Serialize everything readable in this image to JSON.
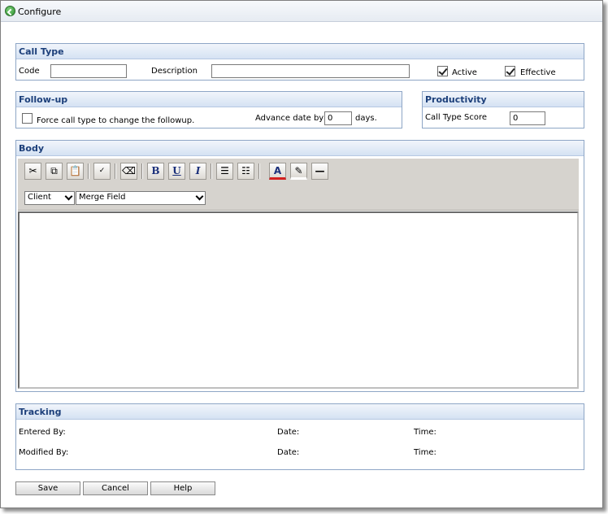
{
  "window": {
    "title": "Configure"
  },
  "call_type": {
    "heading": "Call Type",
    "code_label": "Code",
    "code_value": "",
    "description_label": "Description",
    "description_value": "",
    "active_label": "Active",
    "active_checked": true,
    "effective_label": "Effective",
    "effective_checked": true
  },
  "followup": {
    "heading": "Follow-up",
    "force_label": "Force call type to change the followup.",
    "force_checked": false,
    "advance_label": "Advance date by",
    "advance_value": "0",
    "days_label": "days."
  },
  "productivity": {
    "heading": "Productivity",
    "score_label": "Call Type Score",
    "score_value": "0"
  },
  "body": {
    "heading": "Body",
    "toolbar_icons": [
      "cut-icon",
      "copy-icon",
      "paste-icon",
      "spellcheck-icon",
      "eraser-icon",
      "bold-icon",
      "underline-icon",
      "italic-icon",
      "ordered-list-icon",
      "unordered-list-icon",
      "font-color-icon",
      "highlight-icon",
      "horizontal-rule-icon"
    ],
    "bold_glyph": "B",
    "underline_glyph": "U",
    "italic_glyph": "I",
    "client_select": "Client",
    "merge_select": "Merge Field"
  },
  "tracking": {
    "heading": "Tracking",
    "entered_by_label": "Entered By:",
    "modified_by_label": "Modified By:",
    "date_label": "Date:",
    "time_label": "Time:"
  },
  "buttons": {
    "save": "Save",
    "cancel": "Cancel",
    "help": "Help"
  },
  "colors": {
    "panel_border": "#8ea6c6",
    "heading_text": "#1c3f7a",
    "toolbar_bg": "#d6d3ce"
  }
}
